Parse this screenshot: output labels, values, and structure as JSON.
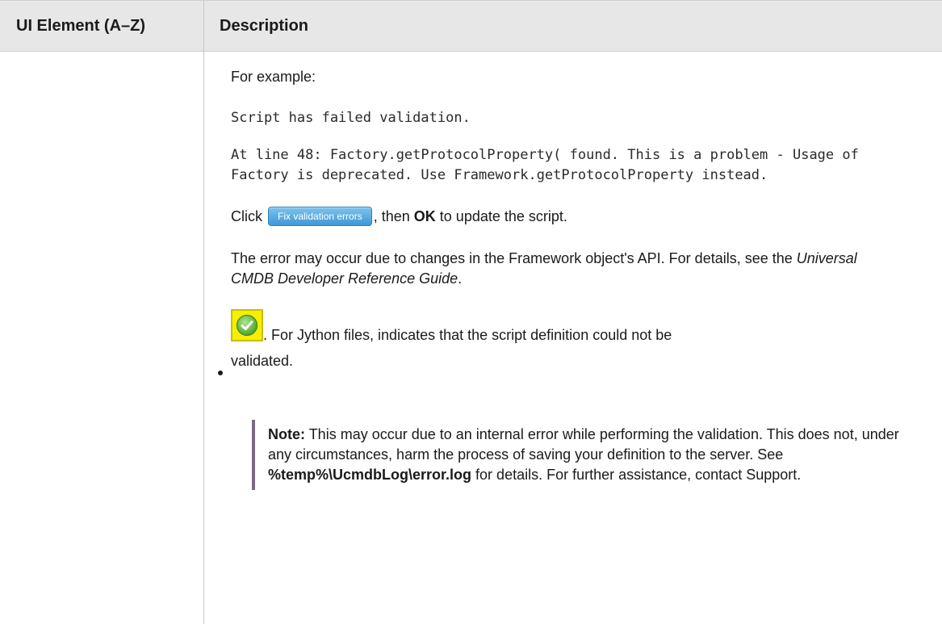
{
  "table": {
    "header": {
      "col1": "UI Element (A–Z)",
      "col2": "Description"
    }
  },
  "content": {
    "for_example": "For example:",
    "code_line_1": "Script has failed validation.",
    "code_line_2": "At line 48: Factory.getProtocolProperty( found. This is a problem - Usage of Factory is deprecated. Use Framework.getProtocolProperty instead.",
    "click_prefix": "Click",
    "fix_button_label": "Fix validation errors",
    "click_mid": ", then",
    "click_ok": "OK",
    "click_suffix": "to update the script.",
    "error_text_1": "The error may occur due to changes in the Framework object's API. For details, see the",
    "error_guide": "Universal CMDB Developer Reference Guide",
    "error_text_2": ".",
    "bullet_text_1": ". For Jython files, indicates that the script definition could not be",
    "bullet_text_2": "validated.",
    "note_label": "Note:",
    "note_text_1": "This may occur due to an internal error while performing the validation. This does not, under any circumstances, harm the process of saving your definition to the server. See",
    "note_path": "%temp%\\UcmdbLog\\error.log",
    "note_text_2": "for details. For further assistance, contact Support."
  },
  "colors": {
    "header_bg": "#e7e7e7",
    "button_blue": "#3e98d6",
    "icon_yellow": "#f7ef00",
    "icon_green": "#6cc04a",
    "note_bar": "#7a6a86"
  },
  "icons": {
    "validated_icon": "green-checkmark-icon"
  }
}
